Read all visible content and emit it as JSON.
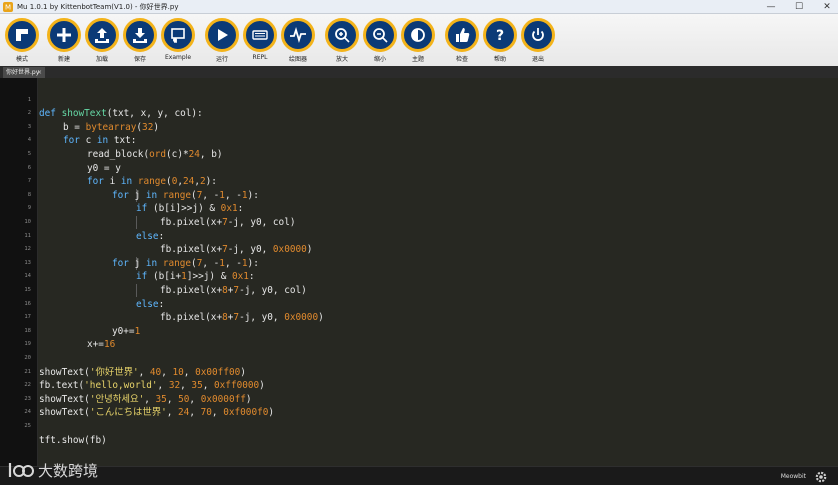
{
  "window": {
    "title": "Mu 1.0.1 by KittenbotTeam(V1.0) - 你好世界.py",
    "controls": [
      "—",
      "☐",
      "✕"
    ]
  },
  "toolbar": {
    "buttons": [
      {
        "label": "模式",
        "icon": "mode-icon"
      },
      {
        "label": "新建",
        "icon": "plus-icon"
      },
      {
        "label": "加载",
        "icon": "upload-icon"
      },
      {
        "label": "保存",
        "icon": "download-icon"
      },
      {
        "label": "Example",
        "icon": "example-icon"
      },
      {
        "label": "运行",
        "icon": "play-icon"
      },
      {
        "label": "REPL",
        "icon": "keyboard-icon"
      },
      {
        "label": "绘图器",
        "icon": "waveform-icon"
      },
      {
        "label": "放大",
        "icon": "zoom-in-icon"
      },
      {
        "label": "缩小",
        "icon": "zoom-out-icon"
      },
      {
        "label": "主题",
        "icon": "theme-icon"
      },
      {
        "label": "检查",
        "icon": "thumbs-up-icon"
      },
      {
        "label": "帮助",
        "icon": "help-icon"
      },
      {
        "label": "退出",
        "icon": "power-icon"
      }
    ]
  },
  "tabs": [
    {
      "label": "你好世界.py",
      "close": "×"
    }
  ],
  "editor": {
    "line_numbers": [
      "1",
      "2",
      "3",
      "4",
      "5",
      "6",
      "7",
      "8",
      "9",
      "10",
      "11",
      "12",
      "13",
      "14",
      "15",
      "16",
      "17",
      "18",
      "19",
      "20",
      "21",
      "22",
      "23",
      "24",
      "25"
    ]
  },
  "code": {
    "l1": {
      "k1": "def ",
      "f": "showText",
      "r": "(txt, x, y, col):"
    },
    "l2": {
      "a": "b = ",
      "bi": "bytearray",
      "b": "(",
      "n": "32",
      "c": ")"
    },
    "l3": {
      "k1": "for ",
      "a": "c ",
      "k2": "in ",
      "b": "txt:"
    },
    "l4": {
      "a": "read_block(",
      "bi": "ord",
      "b": "(c)*",
      "n1": "24",
      "c": ", b)"
    },
    "l5": {
      "a": "y0 = y"
    },
    "l6": {
      "k1": "for ",
      "a": "i ",
      "k2": "in ",
      "bi": "range",
      "b": "(",
      "n1": "0",
      "c": ",",
      "n2": "24",
      "d": ",",
      "n3": "2",
      "e": "):"
    },
    "l7": {
      "k1": "for ",
      "a": "j ",
      "k2": "in ",
      "bi": "range",
      "b": "(",
      "n1": "7",
      "c": ", -",
      "n2": "1",
      "d": ", -",
      "n3": "1",
      "e": "):"
    },
    "l8": {
      "k1": "if ",
      "a": "(b[i]>>j) & ",
      "n1": "0x1",
      "b": ":"
    },
    "l9": {
      "a": "fb.pixel(x+",
      "n1": "7",
      "b": "-j, y0, col)"
    },
    "l10": {
      "k1": "else",
      "a": ":"
    },
    "l11": {
      "a": "fb.pixel(x+",
      "n1": "7",
      "b": "-j, y0, ",
      "n2": "0x0000",
      "c": ")"
    },
    "l12": {
      "k1": "for ",
      "a": "j ",
      "k2": "in ",
      "bi": "range",
      "b": "(",
      "n1": "7",
      "c": ", -",
      "n2": "1",
      "d": ", -",
      "n3": "1",
      "e": "):"
    },
    "l13": {
      "k1": "if ",
      "a": "(b[i+",
      "n1": "1",
      "b": "]>>j) & ",
      "n2": "0x1",
      "c": ":"
    },
    "l14": {
      "a": "fb.pixel(x+",
      "n1": "8",
      "b": "+",
      "n2": "7",
      "c": "-j, y0, col)"
    },
    "l15": {
      "k1": "else",
      "a": ":"
    },
    "l16": {
      "a": "fb.pixel(x+",
      "n1": "8",
      "b": "+",
      "n2": "7",
      "c": "-j, y0, ",
      "n3": "0x0000",
      "d": ")"
    },
    "l17": {
      "a": "y0+=",
      "n1": "1"
    },
    "l18": {
      "a": "x+=",
      "n1": "16"
    },
    "l20": {
      "a": "showText(",
      "s": "'你好世界'",
      "b": ", ",
      "n1": "40",
      "c": ", ",
      "n2": "10",
      "d": ", ",
      "n3": "0x00ff00",
      "e": ")"
    },
    "l21": {
      "a": "fb.text(",
      "s": "'hello,world'",
      "b": ", ",
      "n1": "32",
      "c": ", ",
      "n2": "35",
      "d": ", ",
      "n3": "0xff0000",
      "e": ")"
    },
    "l22": {
      "a": "showText(",
      "s": "'안녕하세요'",
      "b": ", ",
      "n1": "35",
      "c": ", ",
      "n2": "50",
      "d": ", ",
      "n3": "0x0000ff",
      "e": ")"
    },
    "l23": {
      "a": "showText(",
      "s": "'こんにちは世界'",
      "b": ", ",
      "n1": "24",
      "c": ", ",
      "n2": "70",
      "d": ", ",
      "n3": "0xf000f0",
      "e": ")"
    },
    "l25": {
      "a": "tft.show(fb)"
    }
  },
  "statusbar": {
    "mode": "Meowbit",
    "watermark": "大数跨境"
  },
  "colors": {
    "toolbar_button_fill": "#0b3a77",
    "toolbar_button_ring": "#f3b31a",
    "keyword": "#5fb7ff",
    "builtin": "#e08a2e",
    "string": "#e8d46a",
    "function": "#66d9a6"
  }
}
